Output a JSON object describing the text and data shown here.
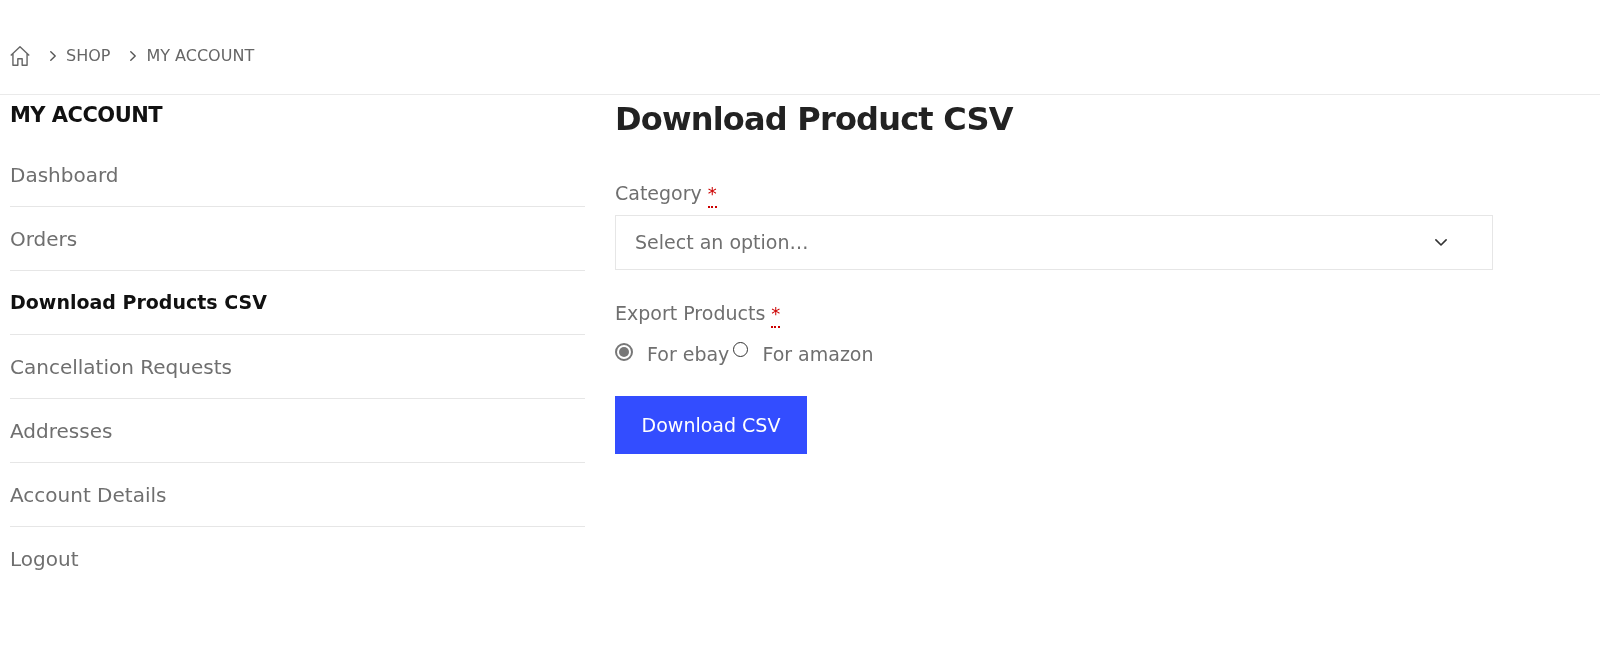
{
  "breadcrumb": {
    "items": [
      "SHOP",
      "MY ACCOUNT"
    ]
  },
  "sidebar": {
    "title": "MY ACCOUNT",
    "items": [
      {
        "label": "Dashboard",
        "selected": false
      },
      {
        "label": "Orders",
        "selected": false
      },
      {
        "label": "Download Products CSV",
        "selected": true
      },
      {
        "label": "Cancellation Requests",
        "selected": false
      },
      {
        "label": "Addresses",
        "selected": false
      },
      {
        "label": "Account Details",
        "selected": false
      },
      {
        "label": "Logout",
        "selected": false
      }
    ]
  },
  "form": {
    "title": "Download Product CSV",
    "fields": [
      {
        "kind": "select",
        "label": "Category",
        "required_mark": "*",
        "value": "Select an option…"
      },
      {
        "kind": "radio",
        "label": "Export Products",
        "required_mark": "*",
        "options": [
          {
            "label": "For ebay",
            "selected": true
          },
          {
            "label": "For amazon",
            "selected": false
          }
        ]
      }
    ],
    "submit": "Download CSV"
  }
}
